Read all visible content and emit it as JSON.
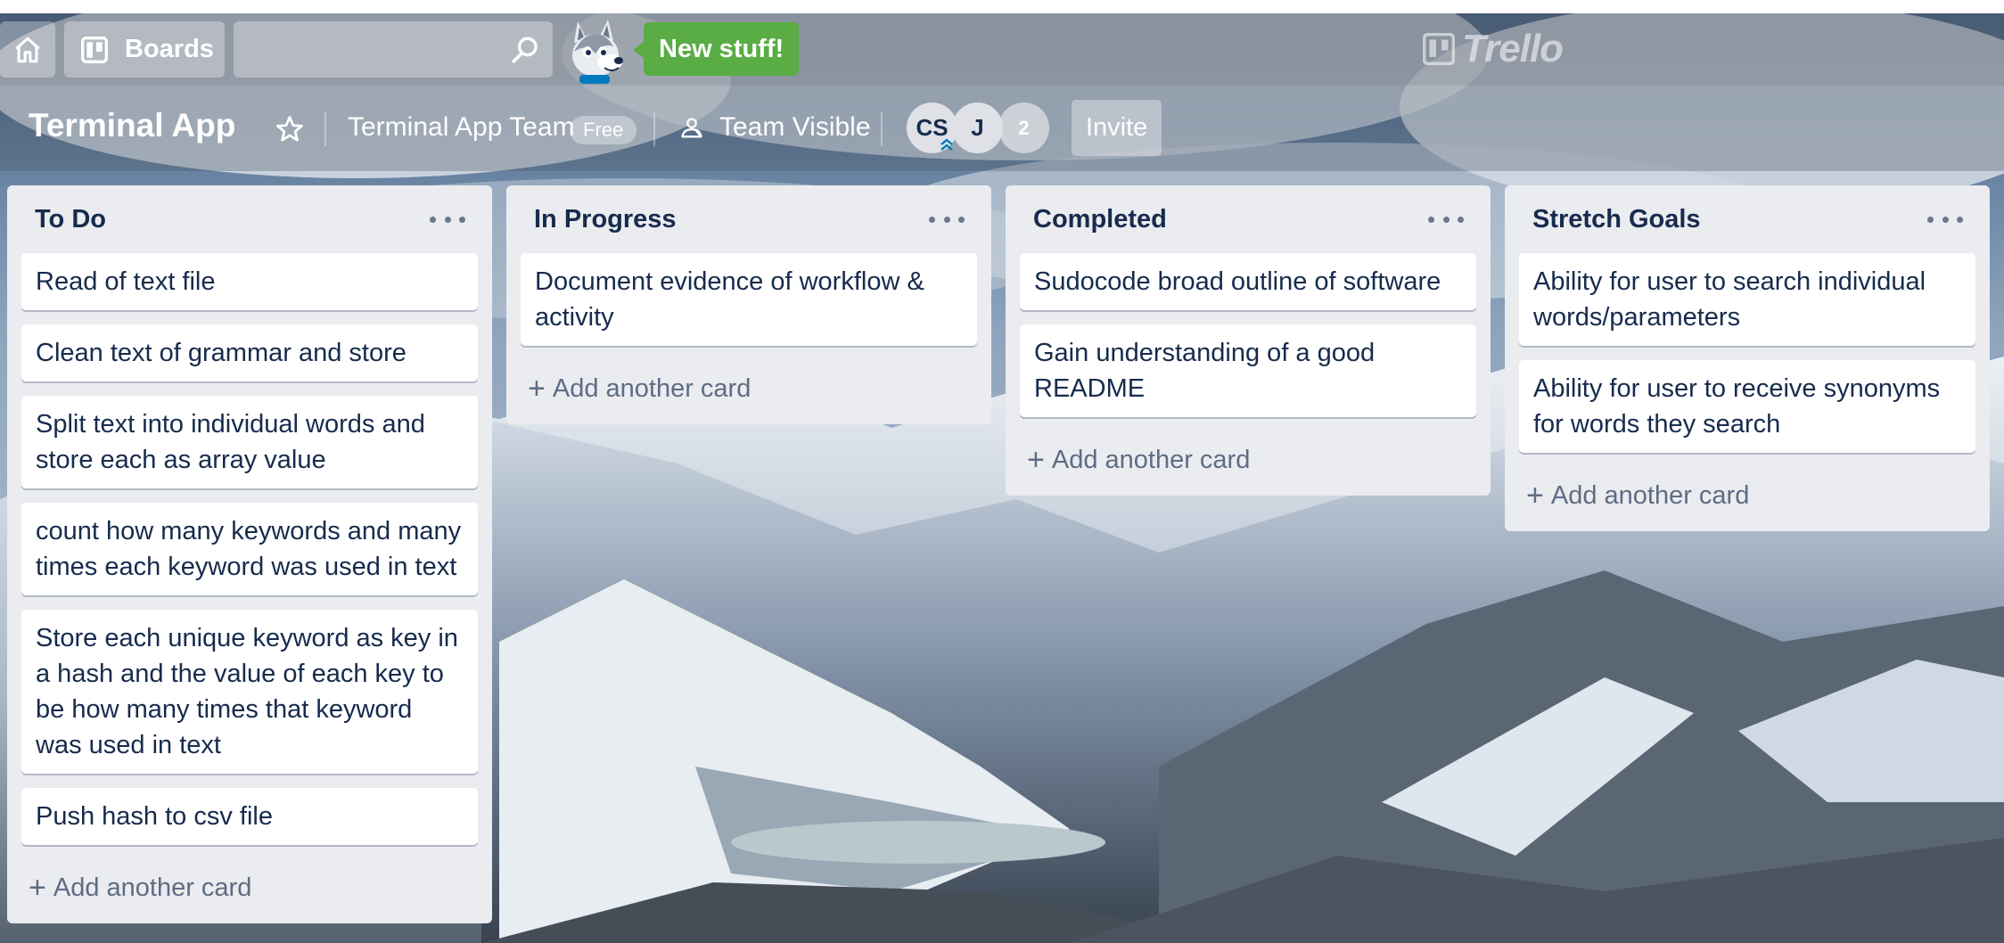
{
  "header": {
    "boards_label": "Boards",
    "search_placeholder": "",
    "new_stuff_label": "New stuff!",
    "logo_text": "Trello"
  },
  "board": {
    "title": "Terminal App",
    "team_name": "Terminal App Team",
    "team_plan": "Free",
    "visibility": "Team Visible",
    "members": [
      "CS",
      "J"
    ],
    "extra_members_count": "2",
    "invite_label": "Invite"
  },
  "lists": [
    {
      "title": "To Do",
      "cards": [
        "Read of text file",
        "Clean text of grammar and store",
        "Split text into individual words and store each as array value",
        "count how many keywords and many times each keyword was used in text",
        "Store each unique keyword as key in a hash and the value of each key to be how many times that keyword was used in text",
        "Push hash to csv file"
      ],
      "add_label": "Add another card"
    },
    {
      "title": "In Progress",
      "cards": [
        "Document evidence of workflow & activity"
      ],
      "add_label": "Add another card"
    },
    {
      "title": "Completed",
      "cards": [
        "Sudocode broad outline of software",
        "Gain understanding of a good README"
      ],
      "add_label": "Add another card"
    },
    {
      "title": "Stretch Goals",
      "cards": [
        "Ability for user to search individual words/parameters",
        "Ability for user to receive synonyms for words they search"
      ],
      "add_label": "Add another card"
    }
  ],
  "colors": {
    "new_stuff_green": "#5aac44",
    "list_bg": "#ebecf0",
    "card_text": "#172b4d"
  }
}
